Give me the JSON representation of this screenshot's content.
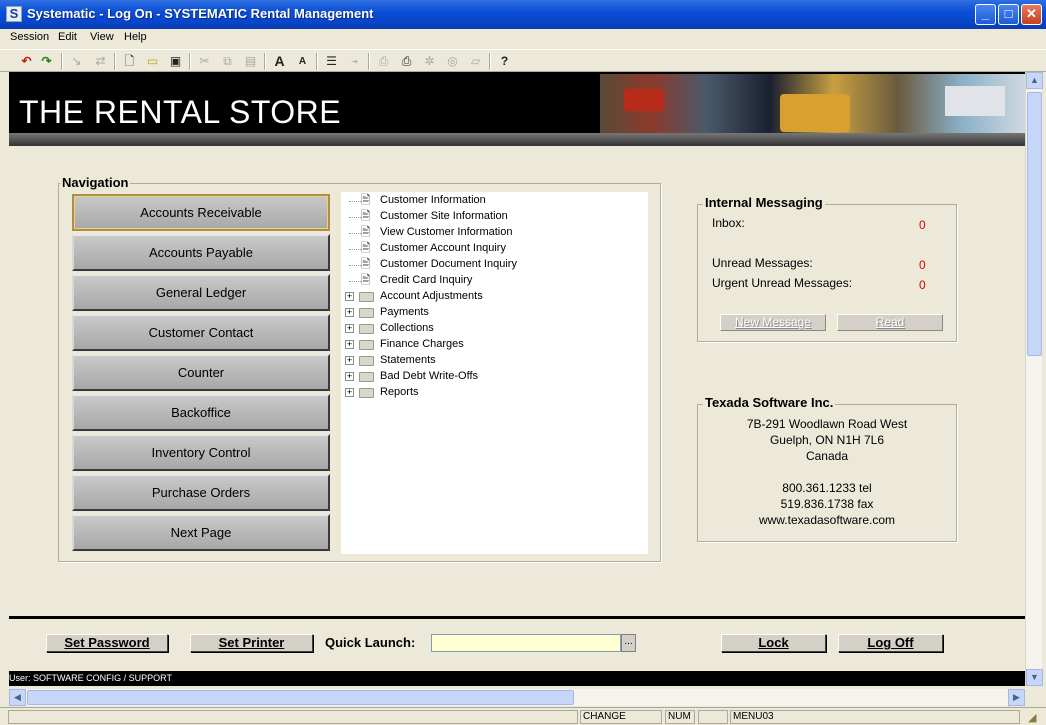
{
  "window": {
    "title": "Systematic - Log On - SYSTEMATIC Rental Management",
    "app_icon": "S",
    "minimize": "_",
    "maximize": "□",
    "close": "✕"
  },
  "menu": [
    "Session",
    "Edit",
    "View",
    "Help"
  ],
  "toolbar_icons": [
    "undo-icon",
    "redo-icon",
    "pointer-icon",
    "arrows-icon",
    "new-document-icon",
    "open-folder-icon",
    "save-icon",
    "cut-icon",
    "copy-icon",
    "paste-icon",
    "font-larger-icon",
    "font-smaller-icon",
    "list-icon",
    "insert-icon",
    "print-preview-icon",
    "print-icon",
    "tool-a-icon",
    "tool-b-icon",
    "tool-c-icon",
    "help-icon"
  ],
  "banner": {
    "store_name": "THE RENTAL STORE"
  },
  "navigation": {
    "label": "Navigation",
    "buttons": [
      "Accounts Receivable",
      "Accounts Payable",
      "General Ledger",
      "Customer Contact",
      "Counter",
      "Backoffice",
      "Inventory Control",
      "Purchase Orders",
      "Next Page"
    ],
    "active_index": 0
  },
  "tree": {
    "items": [
      {
        "label": "Customer Information",
        "type": "doc"
      },
      {
        "label": "Customer Site Information",
        "type": "doc"
      },
      {
        "label": "View Customer Information",
        "type": "doc"
      },
      {
        "label": "Customer Account Inquiry",
        "type": "doc"
      },
      {
        "label": "Customer Document Inquiry",
        "type": "doc"
      },
      {
        "label": "Credit Card Inquiry",
        "type": "doc"
      },
      {
        "label": "Account Adjustments",
        "type": "folder"
      },
      {
        "label": "Payments",
        "type": "folder"
      },
      {
        "label": "Collections",
        "type": "folder"
      },
      {
        "label": "Finance Charges",
        "type": "folder"
      },
      {
        "label": "Statements",
        "type": "folder"
      },
      {
        "label": "Bad Debt Write-Offs",
        "type": "folder"
      },
      {
        "label": "Reports",
        "type": "folder"
      }
    ]
  },
  "messaging": {
    "label": "Internal Messaging",
    "inbox_label": "Inbox:",
    "inbox_value": "0",
    "unread_label": "Unread Messages:",
    "unread_value": "0",
    "urgent_label": "Urgent Unread Messages:",
    "urgent_value": "0",
    "new_message": "New Message",
    "read": "Read"
  },
  "company": {
    "label": "Texada Software Inc.",
    "address1": "7B-291 Woodlawn Road West",
    "address2": "Guelph, ON  N1H 7L6",
    "country": "Canada",
    "phone": "800.361.1233 tel",
    "fax": "519.836.1738 fax",
    "web": "www.texadasoftware.com"
  },
  "bottom": {
    "set_password": "Set Password",
    "set_printer": "Set Printer",
    "quick_launch_label": "Quick Launch:",
    "quick_launch_value": "",
    "browse": "...",
    "lock": "Lock",
    "log_off": "Log Off"
  },
  "userbar": "User: SOFTWARE CONFIG / SUPPORT",
  "status": {
    "change": "CHANGE",
    "num": "NUM",
    "menu": "MENU03"
  }
}
